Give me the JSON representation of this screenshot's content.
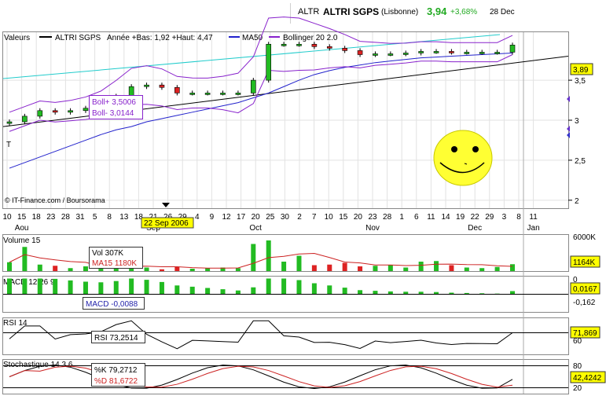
{
  "header": {
    "ticker": "ALTR",
    "name": "ALTRI SGPS",
    "exchange": "(Lisbonne)",
    "price": "3,94",
    "change": "+3,68%",
    "date": "28 Dec"
  },
  "colors": {
    "up": "#22bb22",
    "down": "#dd2222",
    "ma50": "#2222cc",
    "bollinger": "#8822cc",
    "trend": "#22cccc",
    "price_label_bg": "#ffff00",
    "grid": "#dddddd"
  },
  "main": {
    "legend": {
      "values": "Valeurs",
      "instrument": "ALTRI SGPS",
      "range": "Année +Bas: 1,92 +Haut: 4,47",
      "ma": "MA50",
      "boll": "Bollinger 20 2.0"
    },
    "boll_box": {
      "upper": "Boll+ 3,5006",
      "lower": "Boll- 3,0144"
    },
    "credit": "© IT-Finance.com / Boursorama",
    "marker_label": "T",
    "current_price": "3,89",
    "yticks": [
      "3,5",
      "3",
      "2,5",
      "2"
    ],
    "yrange": [
      1.9,
      4.1
    ]
  },
  "xaxis": {
    "ticks": [
      "10",
      "15",
      "18",
      "23",
      "28",
      "31",
      "5",
      "8",
      "13",
      "18",
      "21",
      "26",
      "29",
      "4",
      "9",
      "12",
      "17",
      "20",
      "25",
      "30",
      "2",
      "7",
      "10",
      "15",
      "20",
      "23",
      "28",
      "1",
      "6",
      "11",
      "14",
      "19",
      "22",
      "29",
      "3",
      "8",
      "11"
    ],
    "months": [
      "Aou",
      "Sep",
      "Oct",
      "Nov",
      "Dec",
      "Jan"
    ],
    "highlight": "22 Sep 2006"
  },
  "volume": {
    "title": "Volume 15",
    "vol": "Vol   307K",
    "ma15": "MA15  1180K",
    "ymax": "6000K",
    "ymin": "0",
    "current": "1164K"
  },
  "macd": {
    "title": "MACD 12 26 9",
    "value": "MACD -0,0088",
    "y0": "0",
    "current": "0,0167",
    "ylo": "-0,162"
  },
  "rsi": {
    "title": "RSI 14",
    "value": "RSI 73,2514",
    "y60": "60",
    "current": "71,869"
  },
  "stoch": {
    "title": "Stochastique 14 3 6",
    "k": "%K 79,2712",
    "d": "%D 81,6722",
    "y80": "80",
    "y20": "20",
    "current": "42,4242"
  },
  "chart_data": {
    "type": "line",
    "title": "ALTRI SGPS",
    "ylabel": "",
    "xlabel": "",
    "ylim": [
      1.9,
      4.1
    ],
    "x": [
      "10 Aou",
      "15 Aou",
      "18 Aou",
      "23 Aou",
      "28 Aou",
      "31 Aou",
      "5 Sep",
      "8 Sep",
      "13 Sep",
      "18 Sep",
      "21 Sep",
      "26 Sep",
      "29 Sep",
      "4 Oct",
      "9 Oct",
      "12 Oct",
      "17 Oct",
      "20 Oct",
      "25 Oct",
      "30 Oct",
      "2 Nov",
      "7 Nov",
      "10 Nov",
      "15 Nov",
      "20 Nov",
      "23 Nov",
      "28 Nov",
      "1 Dec",
      "6 Dec",
      "11 Dec",
      "14 Dec",
      "19 Dec",
      "22 Dec",
      "28 Dec"
    ],
    "series": [
      {
        "name": "ALTRI SGPS",
        "values": [
          2.98,
          3.05,
          3.12,
          3.1,
          3.12,
          3.15,
          3.2,
          3.3,
          3.42,
          3.44,
          3.41,
          3.34,
          3.34,
          3.34,
          3.34,
          3.34,
          3.5,
          3.95,
          3.95,
          3.95,
          3.92,
          3.9,
          3.87,
          3.82,
          3.83,
          3.83,
          3.84,
          3.86,
          3.86,
          3.85,
          3.85,
          3.85,
          3.85,
          3.94
        ]
      },
      {
        "name": "MA50",
        "values": [
          2.4,
          2.47,
          2.54,
          2.61,
          2.68,
          2.75,
          2.82,
          2.88,
          2.92,
          2.98,
          3.02,
          3.06,
          3.1,
          3.14,
          3.18,
          3.22,
          3.28,
          3.34,
          3.42,
          3.5,
          3.57,
          3.62,
          3.66,
          3.69,
          3.72,
          3.74,
          3.76,
          3.78,
          3.79,
          3.8,
          3.81,
          3.82,
          3.83,
          3.84
        ]
      }
    ],
    "bollinger": {
      "upper": "3,5006",
      "lower": "3,0144"
    },
    "volume_K": [
      1500,
      4100,
      1100,
      900,
      500,
      800,
      700,
      1200,
      900,
      600,
      300,
      700,
      400,
      500,
      600,
      500,
      4600,
      5200,
      1600,
      2600,
      1000,
      1100,
      1400,
      800,
      900,
      1000,
      600,
      1600,
      1700,
      1000,
      600,
      500,
      700,
      1164
    ],
    "macd_current": 0.0167,
    "rsi_current": 71.869,
    "stoch_current": 42.4242
  }
}
